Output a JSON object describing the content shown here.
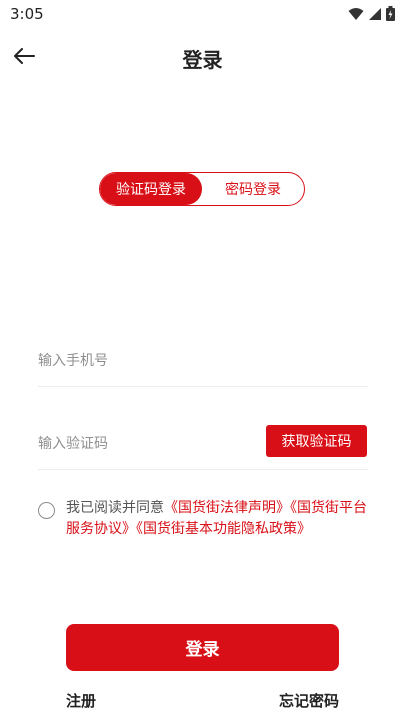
{
  "status_bar": {
    "time": "3:05",
    "icons": [
      "wifi-icon",
      "signal-icon",
      "battery-icon"
    ]
  },
  "header": {
    "title": "登录",
    "back_icon": "arrow-left-icon"
  },
  "login_tabs": {
    "tabs": [
      {
        "label": "验证码登录",
        "active": true
      },
      {
        "label": "密码登录",
        "active": false
      }
    ]
  },
  "form": {
    "phone_placeholder": "输入手机号",
    "code_placeholder": "输入验证码",
    "get_code_label": "获取验证码"
  },
  "agreement": {
    "prefix": "我已阅读并同意",
    "links": [
      "《国货街法律声明》",
      "《国货街平台服务协议》",
      "《国货街基本功能隐私政策》"
    ],
    "checked": false
  },
  "actions": {
    "login_label": "登录",
    "register_label": "注册",
    "forgot_label": "忘记密码"
  },
  "colors": {
    "brand": "#d80f16",
    "text": "#222222",
    "placeholder": "#8f8f8f"
  }
}
